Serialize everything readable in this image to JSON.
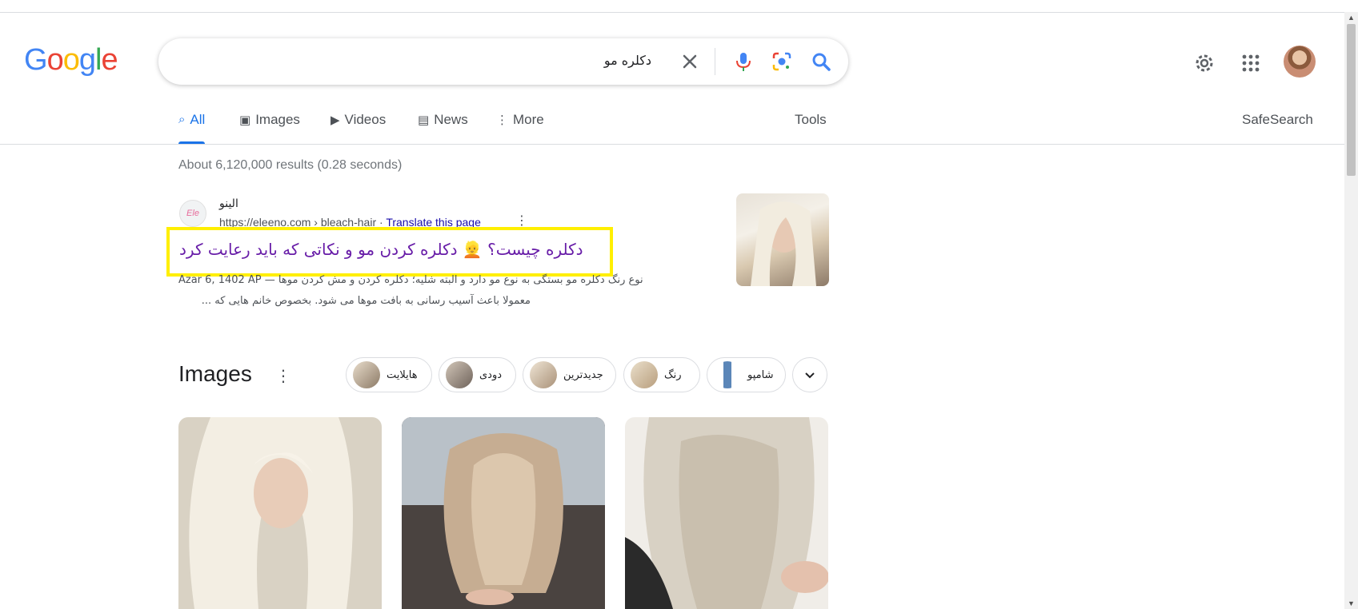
{
  "logo": {
    "text": "Google",
    "letters": [
      {
        "ch": "G",
        "color": "#4285f4"
      },
      {
        "ch": "o",
        "color": "#ea4335"
      },
      {
        "ch": "o",
        "color": "#fbbc05"
      },
      {
        "ch": "g",
        "color": "#4285f4"
      },
      {
        "ch": "l",
        "color": "#34a853"
      },
      {
        "ch": "e",
        "color": "#ea4335"
      }
    ]
  },
  "search": {
    "query": "دکلره مو"
  },
  "header": {
    "settings_icon": "gear-icon",
    "apps_icon": "apps-grid-icon"
  },
  "tabs": [
    {
      "label": "All",
      "icon": "⌕",
      "active": true
    },
    {
      "label": "Images",
      "icon": "▣"
    },
    {
      "label": "Videos",
      "icon": "▶"
    },
    {
      "label": "News",
      "icon": "▤"
    },
    {
      "label": "More",
      "icon": "⋮"
    }
  ],
  "tools_label": "Tools",
  "safesearch_label": "SafeSearch",
  "stats": "About 6,120,000 results (0.28 seconds)",
  "result": {
    "site_name": "الینو",
    "url": "https://eleeno.com › bleach-hair",
    "translate": "Translate this page",
    "title": "دکلره چیست؟ 👱 دکلره کردن مو و نکاتی که باید رعایت کرد",
    "date": "Azar 6, 1402 AP —",
    "snippet_line1": "نوع رنگ دکلره مو بستگی به نوع مو دارد و البته شلیه؛ دکلره کردن و مش کردن موها",
    "snippet_line2": "معمولا باعث آسیب رسانی به بافت موها می شود. بخصوص خانم هایی که ..."
  },
  "images_section": {
    "heading": "Images",
    "chips": [
      {
        "label": "هایلایت",
        "color": "#b8a48a"
      },
      {
        "label": "دودی",
        "color": "#8a8078"
      },
      {
        "label": "جدیدترین",
        "color": "#c9b49a"
      },
      {
        "label": "رنگ",
        "color": "#d4bf9e"
      },
      {
        "label": "شامپو",
        "color": "#5b86b8"
      }
    ],
    "images": [
      {
        "alt": "platinum-blonde-portrait",
        "colors": [
          "#efeae0",
          "#d8cdb8",
          "#b8a98f"
        ]
      },
      {
        "alt": "highlighted-hair-back",
        "colors": [
          "#c7b29b",
          "#9c8670",
          "#3a3432"
        ]
      },
      {
        "alt": "ash-blonde-hair",
        "colors": [
          "#e5e0d6",
          "#cfc7b8",
          "#a89d8c"
        ]
      }
    ]
  }
}
